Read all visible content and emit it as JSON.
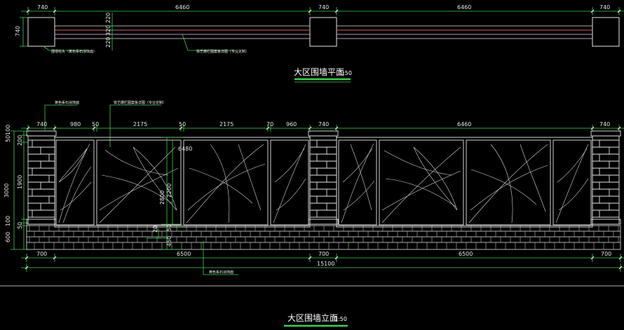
{
  "plan": {
    "top_dims": [
      "740",
      "6460",
      "740",
      "6460",
      "740"
    ],
    "left_dim": "740",
    "rail_dims": [
      "220",
      "320",
      "220"
    ],
    "note_pier": "围墙柱头（黄色系石涂饰面）",
    "note_panel": "铁艺栅栏图案板详图（专业定制）",
    "title": "大区围墙平面",
    "scale": "1:50"
  },
  "elevation": {
    "notes": {
      "pier_top": "黄色系石涂饰面",
      "panel": "铁艺栅栏图案板详图（专业定制）",
      "base": "黄色系石涂饰面"
    },
    "top_dims": [
      "740",
      "980",
      "50",
      "2175",
      "50",
      "2175",
      "70",
      "960",
      "740",
      "6460",
      "740"
    ],
    "left_dims": [
      "100",
      "50",
      "200",
      "3000",
      "1900",
      "100",
      "50",
      "600"
    ],
    "inner_dims": [
      "6480",
      "2200",
      "2800",
      "20",
      "50",
      "450"
    ],
    "bottom_dims": [
      "700",
      "6500",
      "700",
      "6500",
      "700"
    ],
    "total": "15100",
    "title": "大区围墙立面",
    "scale": "1:50"
  }
}
